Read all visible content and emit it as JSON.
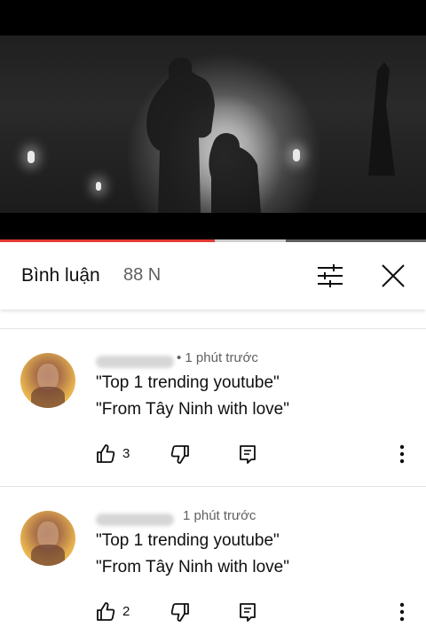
{
  "video": {
    "progress_played": 0.505,
    "progress_buffered": 0.67
  },
  "header": {
    "title": "Bình luận",
    "count": "88 N"
  },
  "comments": [
    {
      "time": "• 1 phút trước",
      "line1": "\"Top 1 trending youtube\"",
      "line2": "\"From Tây Ninh with love\"",
      "likes": "3"
    },
    {
      "time": "1 phút trước",
      "line1": "\"Top 1 trending youtube\"",
      "line2": "\"From Tây Ninh with love\"",
      "likes": "2"
    }
  ],
  "icons": {
    "filter": "sliders-icon",
    "close": "close-icon",
    "like": "thumb-up-icon",
    "dislike": "thumb-down-icon",
    "reply": "comment-reply-icon",
    "more": "more-vert-icon"
  },
  "colors": {
    "progress_played": "#e53935",
    "secondary_text": "#606060"
  }
}
